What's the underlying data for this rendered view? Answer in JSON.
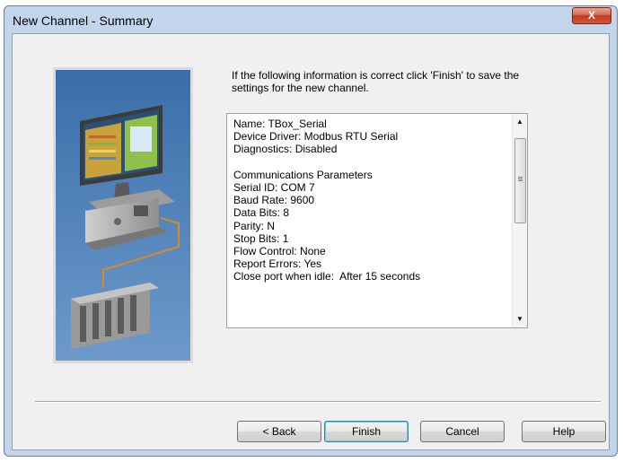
{
  "window": {
    "title": "New Channel - Summary",
    "close_glyph": "X"
  },
  "intro_text": "If the following information is correct click 'Finish' to save the settings for the new channel.",
  "summary": {
    "lines": [
      "Name: TBox_Serial",
      "Device Driver: Modbus RTU Serial",
      "Diagnostics: Disabled",
      "",
      "Communications Parameters",
      "Serial ID: COM 7",
      "Baud Rate: 9600",
      "Data Bits: 8",
      "Parity: N",
      "Stop Bits: 1",
      "Flow Control: None",
      "Report Errors: Yes",
      "Close port when idle:  After 15 seconds"
    ]
  },
  "buttons": {
    "back": "< Back",
    "finish": "Finish",
    "cancel": "Cancel",
    "help": "Help"
  },
  "icons": {
    "illustration": "computer-connected-to-plc-illustration",
    "close": "close-icon",
    "scroll_up": "scroll-up-arrow-icon",
    "scroll_down": "scroll-down-arrow-icon"
  },
  "colors": {
    "close_button": "#c74a2e",
    "frame": "#c3d5ea",
    "client_bg": "#f0f0f0"
  }
}
